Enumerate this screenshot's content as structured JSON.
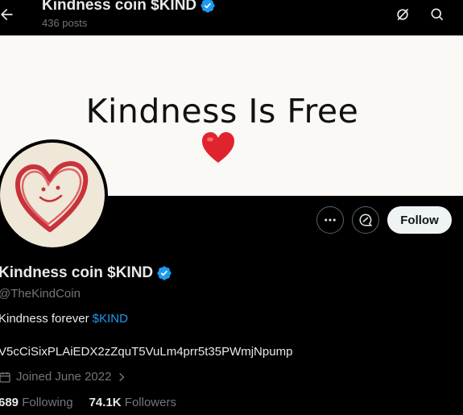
{
  "header": {
    "title": "Kindness coin $KIND",
    "posts": "436 posts"
  },
  "banner": {
    "text": "Kindness Is Free"
  },
  "actions": {
    "follow_label": "Follow"
  },
  "profile": {
    "name": "Kindness coin $KIND",
    "handle": "@TheKindCoin",
    "bio_prefix": "Kindness forever ",
    "bio_tag": "$KIND",
    "address": "V5cCiSixPLAiEDX2zZquT5VuLm4prr5t35PWmjNpump",
    "joined": "Joined June 2022",
    "following_count": "689",
    "following_label": "Following",
    "followers_count": "74.1K",
    "followers_label": "Followers"
  },
  "colors": {
    "accent": "#1d9bf0",
    "verified": "#1d9bf0",
    "heart": "#e0242e"
  }
}
